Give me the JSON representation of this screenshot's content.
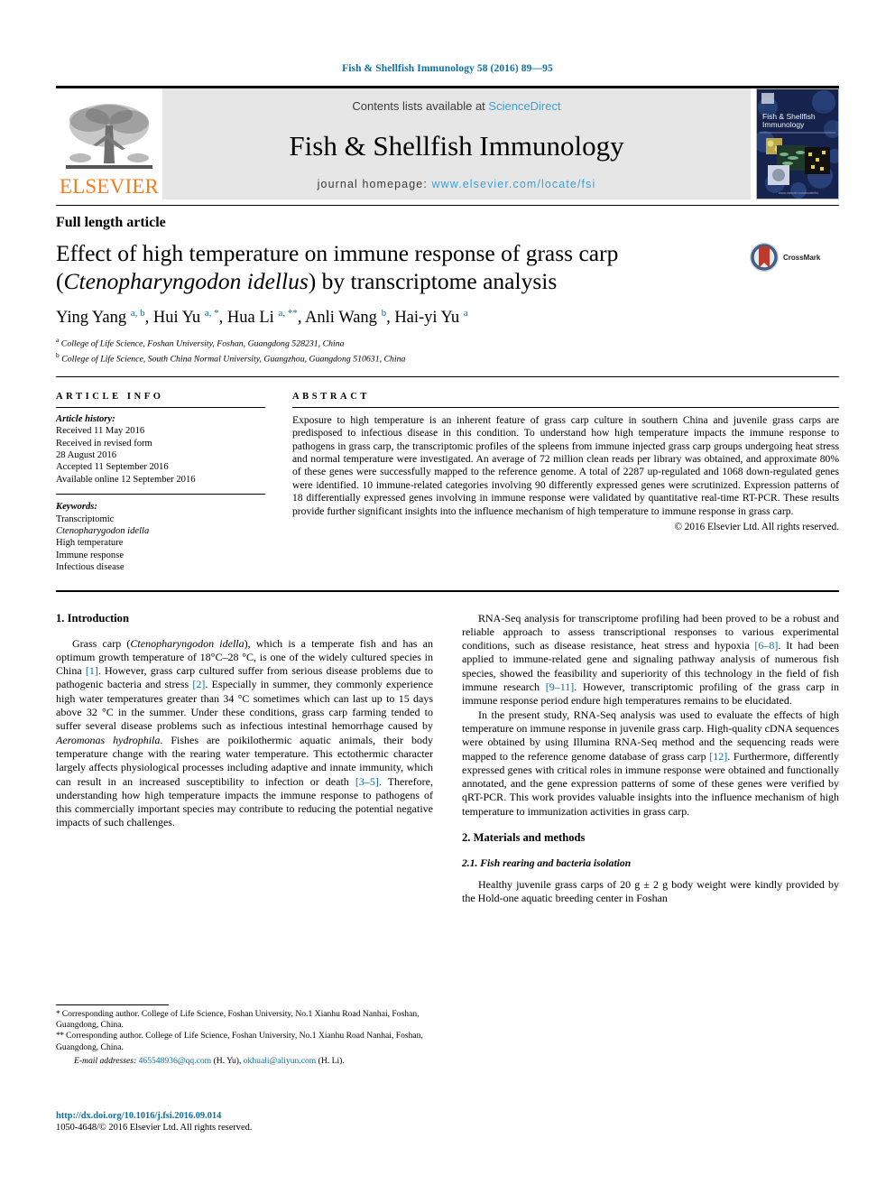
{
  "running_head": "Fish & Shellfish Immunology 58 (2016) 89––95",
  "masthead": {
    "publisher_name": "ELSEVIER",
    "contents_prefix": "Contents lists available at ",
    "sciencedirect": "ScienceDirect",
    "journal_name": "Fish & Shellfish Immunology",
    "homepage_prefix": "journal homepage: ",
    "homepage_url": "www.elsevier.com/locate/fsi",
    "cover_title_line1": "Fish & Shellfish",
    "cover_title_line2": "Immunology",
    "cover_footer": "www.elsevier.com/locate/fsi"
  },
  "article": {
    "type": "Full length article",
    "title_part1": "Effect of high temperature on immune response of grass carp (",
    "title_species": "Ctenopharyngodon idellus",
    "title_part2": ") by transcriptome analysis",
    "crossmark_label": "CrossMark",
    "authors": "Ying Yang, Hui Yu, Hua Li, Anli Wang, Hai-yi Yu",
    "affiliation_a": "College of Life Science, Foshan University, Foshan, Guangdong 528231, China",
    "affiliation_b": "College of Life Science, South China Normal University, Guangzhou, Guangdong 510631, China"
  },
  "article_info": {
    "heading": "ARTICLE INFO",
    "history_label": "Article history:",
    "received": "Received 11 May 2016",
    "revised_label": "Received in revised form",
    "revised_date": "28 August 2016",
    "accepted": "Accepted 11 September 2016",
    "online": "Available online 12 September 2016",
    "keywords_label": "Keywords:",
    "keywords": [
      "Transcriptomic",
      "Ctenopharygodon idella",
      "High temperature",
      "Immune response",
      "Infectious disease"
    ]
  },
  "abstract": {
    "heading": "ABSTRACT",
    "text": "Exposure to high temperature is an inherent feature of grass carp culture in southern China and juvenile grass carps are predisposed to infectious disease in this condition. To understand how high temperature impacts the immune response to pathogens in grass carp, the transcriptomic profiles of the spleens from immune injected grass carp groups undergoing heat stress and normal temperature were investigated. An average of 72 million clean reads per library was obtained, and approximate 80% of these genes were successfully mapped to the reference genome. A total of 2287 up-regulated and 1068 down-regulated genes were identified. 10 immune-related categories involving 90 differently expressed genes were scrutinized. Expression patterns of 18 differentially expressed genes involving in immune response were validated by quantitative real-time RT-PCR. These results provide further significant insights into the influence mechanism of high temperature to immune response in grass carp.",
    "copyright": "© 2016 Elsevier Ltd. All rights reserved."
  },
  "sections": {
    "intro_heading": "1. Introduction",
    "intro_p1_a": "Grass carp (",
    "intro_p1_sp": "Ctenopharyngodon idella",
    "intro_p1_b": "), which is a temperate fish and has an optimum growth temperature of 18°C–28 °C, is one of the widely cultured species in China ",
    "intro_p1_ref1": "[1]",
    "intro_p1_c": ". However, grass carp cultured suffer from serious disease problems due to pathogenic bacteria and stress ",
    "intro_p1_ref2": "[2]",
    "intro_p1_d": ". Especially in summer, they commonly experience high water temperatures greater than 34 °C sometimes which can last up to 15 days above 32 °C in the summer. Under these conditions, grass carp farming tended to suffer several disease problems such as infectious intestinal hemorrhage caused by ",
    "intro_p1_sp2": "Aeromonas hydrophila",
    "intro_p1_e": ". Fishes are poikilothermic aquatic animals, their body temperature change with the rearing water temperature. This ectothermic character largely affects physiological processes including adaptive and innate immunity, which can result in an increased susceptibility to infection or death ",
    "intro_p1_ref3": "[3–5]",
    "intro_p1_f": ". Therefore, understanding how high temperature impacts the immune response to pathogens of this commercially important species may contribute to reducing the potential negative impacts of such challenges.",
    "intro_p2_a": "RNA-Seq analysis for transcriptome profiling had been proved to be a robust and reliable approach to assess transcriptional responses to various experimental conditions, such as disease resistance, heat stress and hypoxia ",
    "intro_p2_ref1": "[6–8]",
    "intro_p2_b": ". It had been applied to immune-related gene and signaling pathway analysis of numerous fish species, showed the feasibility and superiority of this technology in the field of fish immune research ",
    "intro_p2_ref2": "[9–11]",
    "intro_p2_c": ". However, transcriptomic profiling of the grass carp in immune response period endure high temperatures remains to be elucidated.",
    "intro_p3_a": "In the present study, RNA-Seq analysis was used to evaluate the effects of high temperature on immune response in juvenile grass carp. High-quality cDNA sequences were obtained by using Illumina RNA-Seq method and the sequencing reads were mapped to the reference genome database of grass carp ",
    "intro_p3_ref1": "[12]",
    "intro_p3_b": ". Furthermore, differently expressed genes with critical roles in immune response were obtained and functionally annotated, and the gene expression patterns of some of these genes were verified by qRT-PCR. This work provides valuable insights into the influence mechanism of high temperature to immunization activities in grass carp.",
    "methods_heading": "2. Materials and methods",
    "methods_sub1": "2.1. Fish rearing and bacteria isolation",
    "methods_p1": "Healthy juvenile grass carps of 20 g ± 2 g body weight were kindly provided by the Hold-one aquatic breeding center in Foshan"
  },
  "footnotes": {
    "fn1_star": "*",
    "fn1": "Corresponding author. College of Life Science, Foshan University, No.1 Xianhu Road Nanhai, Foshan, Guangdong, China.",
    "fn2_star": "**",
    "fn2": "Corresponding author. College of Life Science, Foshan University, No.1 Xianhu Road Nanhai, Foshan, Guangdong, China.",
    "email_label": "E-mail addresses: ",
    "email1": "465548936@qq.com",
    "email1_who": " (H. Yu), ",
    "email2": "okhuali@aliyun.com",
    "email2_who": " (H. Li).",
    "doi": "http://dx.doi.org/10.1016/j.fsi.2016.09.014",
    "issn": "1050-4648/© 2016 Elsevier Ltd. All rights reserved."
  },
  "colors": {
    "link_blue": "#0b6fa4",
    "sd_blue": "#3fa0d4",
    "elsevier_orange": "#ef7d22",
    "band_gray": "#e6e6e6",
    "cover_navy": "#17244d"
  }
}
